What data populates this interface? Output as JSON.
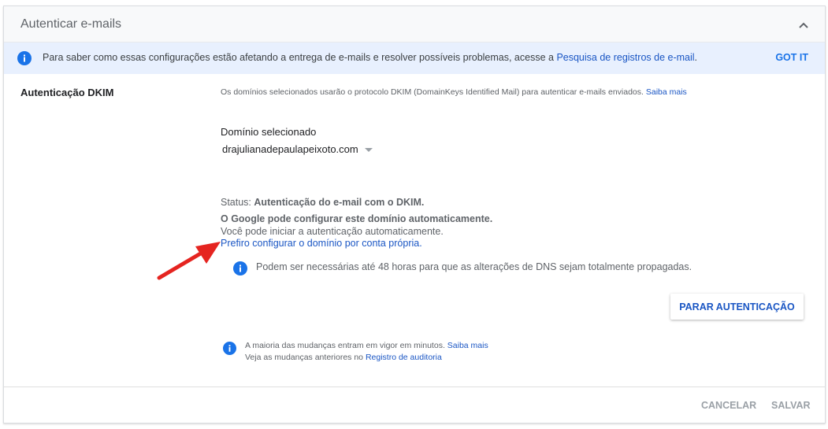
{
  "header": {
    "title": "Autenticar e-mails",
    "collapse_icon": "chevron-up-icon"
  },
  "banner": {
    "text": "Para saber como essas configurações estão afetando a entrega de e-mails e resolver possíveis problemas, acesse a ",
    "link": "Pesquisa de registros de e-mail",
    "suffix": ".",
    "dismiss": "GOT IT",
    "icon": "info-icon"
  },
  "dkim": {
    "label": "Autenticação DKIM",
    "description": "Os domínios selecionados usarão o protocolo DKIM (DomainKeys Identified Mail) para autenticar e-mails enviados.",
    "learn_more": "Saiba mais"
  },
  "domain": {
    "label": "Domínio selecionado",
    "value": "drajulianadepaulapeixoto.com"
  },
  "status": {
    "prefix": "Status:",
    "value": "Autenticação do e-mail com o DKIM.",
    "auto_title": "O Google pode configurar este domínio automaticamente.",
    "auto_sub": "Você pode iniciar a autenticação automaticamente.",
    "own_link": "Prefiro configurar o domínio por conta própria."
  },
  "dns_note": "Podem ser necessárias até 48 horas para que as alterações de DNS sejam totalmente propagadas.",
  "stop_button": "PARAR AUTENTICAÇÃO",
  "note": {
    "line1": "A maioria das mudanças entram em vigor em minutos.",
    "line1_link": "Saiba mais",
    "line2": "Veja as mudanças anteriores no",
    "line2_link": "Registro de auditoria"
  },
  "footer": {
    "cancel": "CANCELAR",
    "save": "SALVAR"
  },
  "colors": {
    "accent": "#1a73e8",
    "banner_bg": "#e8f0fe",
    "arrow": "#e52420"
  }
}
